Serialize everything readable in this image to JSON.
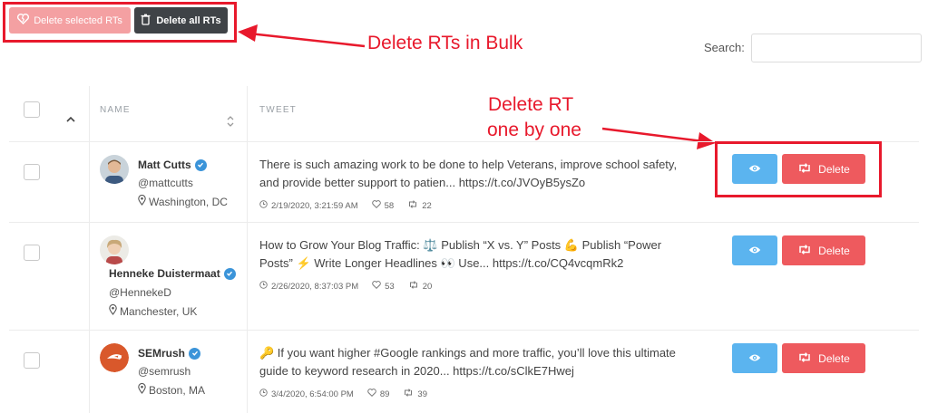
{
  "toolbar": {
    "delete_selected_label": "Delete selected RTs",
    "delete_all_label": "Delete all RTs"
  },
  "annotations": {
    "bulk": "Delete RTs in Bulk",
    "single_line1": "Delete RT",
    "single_line2": "one by one"
  },
  "search": {
    "label": "Search:",
    "value": "",
    "placeholder": ""
  },
  "table": {
    "headers": {
      "name": "NAME",
      "tweet": "TWEET"
    },
    "rows": [
      {
        "name": "Matt Cutts",
        "handle": "@mattcutts",
        "location": "Washington, DC",
        "tweet_line1": "There is such amazing work to be done to help Veterans, improve school safety,",
        "tweet_line2": "and provide better support to patien... https://t.co/JVOyB5ysZo",
        "date": "2/19/2020, 3:21:59 AM",
        "likes": "58",
        "retweets": "22",
        "delete_label": "Delete"
      },
      {
        "name": "Henneke Duistermaat",
        "handle": "@HennekeD",
        "location": "Manchester, UK",
        "tweet_line1_a": "How to Grow Your Blog Traffic: ",
        "tweet_line1_b": " Publish “X vs. Y” Posts ",
        "tweet_line1_c": " Publish “Power",
        "tweet_line2_a": "Posts” ",
        "tweet_line2_b": " Write Longer Headlines ",
        "tweet_line2_c": " Use... https://t.co/CQ4vcqmRk2",
        "date": "2/26/2020, 8:37:03 PM",
        "likes": "53",
        "retweets": "20",
        "delete_label": "Delete"
      },
      {
        "name": "SEMrush",
        "handle": "@semrush",
        "location": "Boston, MA",
        "tweet_line1": " If you want higher #Google rankings and more traffic, you’ll love this ultimate",
        "tweet_line2": "guide to keyword research in 2020... https://t.co/sClkE7Hwej",
        "date": "3/4/2020, 6:54:00 PM",
        "likes": "89",
        "retweets": "39",
        "delete_label": "Delete"
      }
    ]
  },
  "colors": {
    "annotation_red": "#e8192c",
    "delete_red": "#ee5a5e",
    "view_blue": "#5bb4ef",
    "dark_button": "#3f4347",
    "verified_blue": "#3b94d9"
  }
}
